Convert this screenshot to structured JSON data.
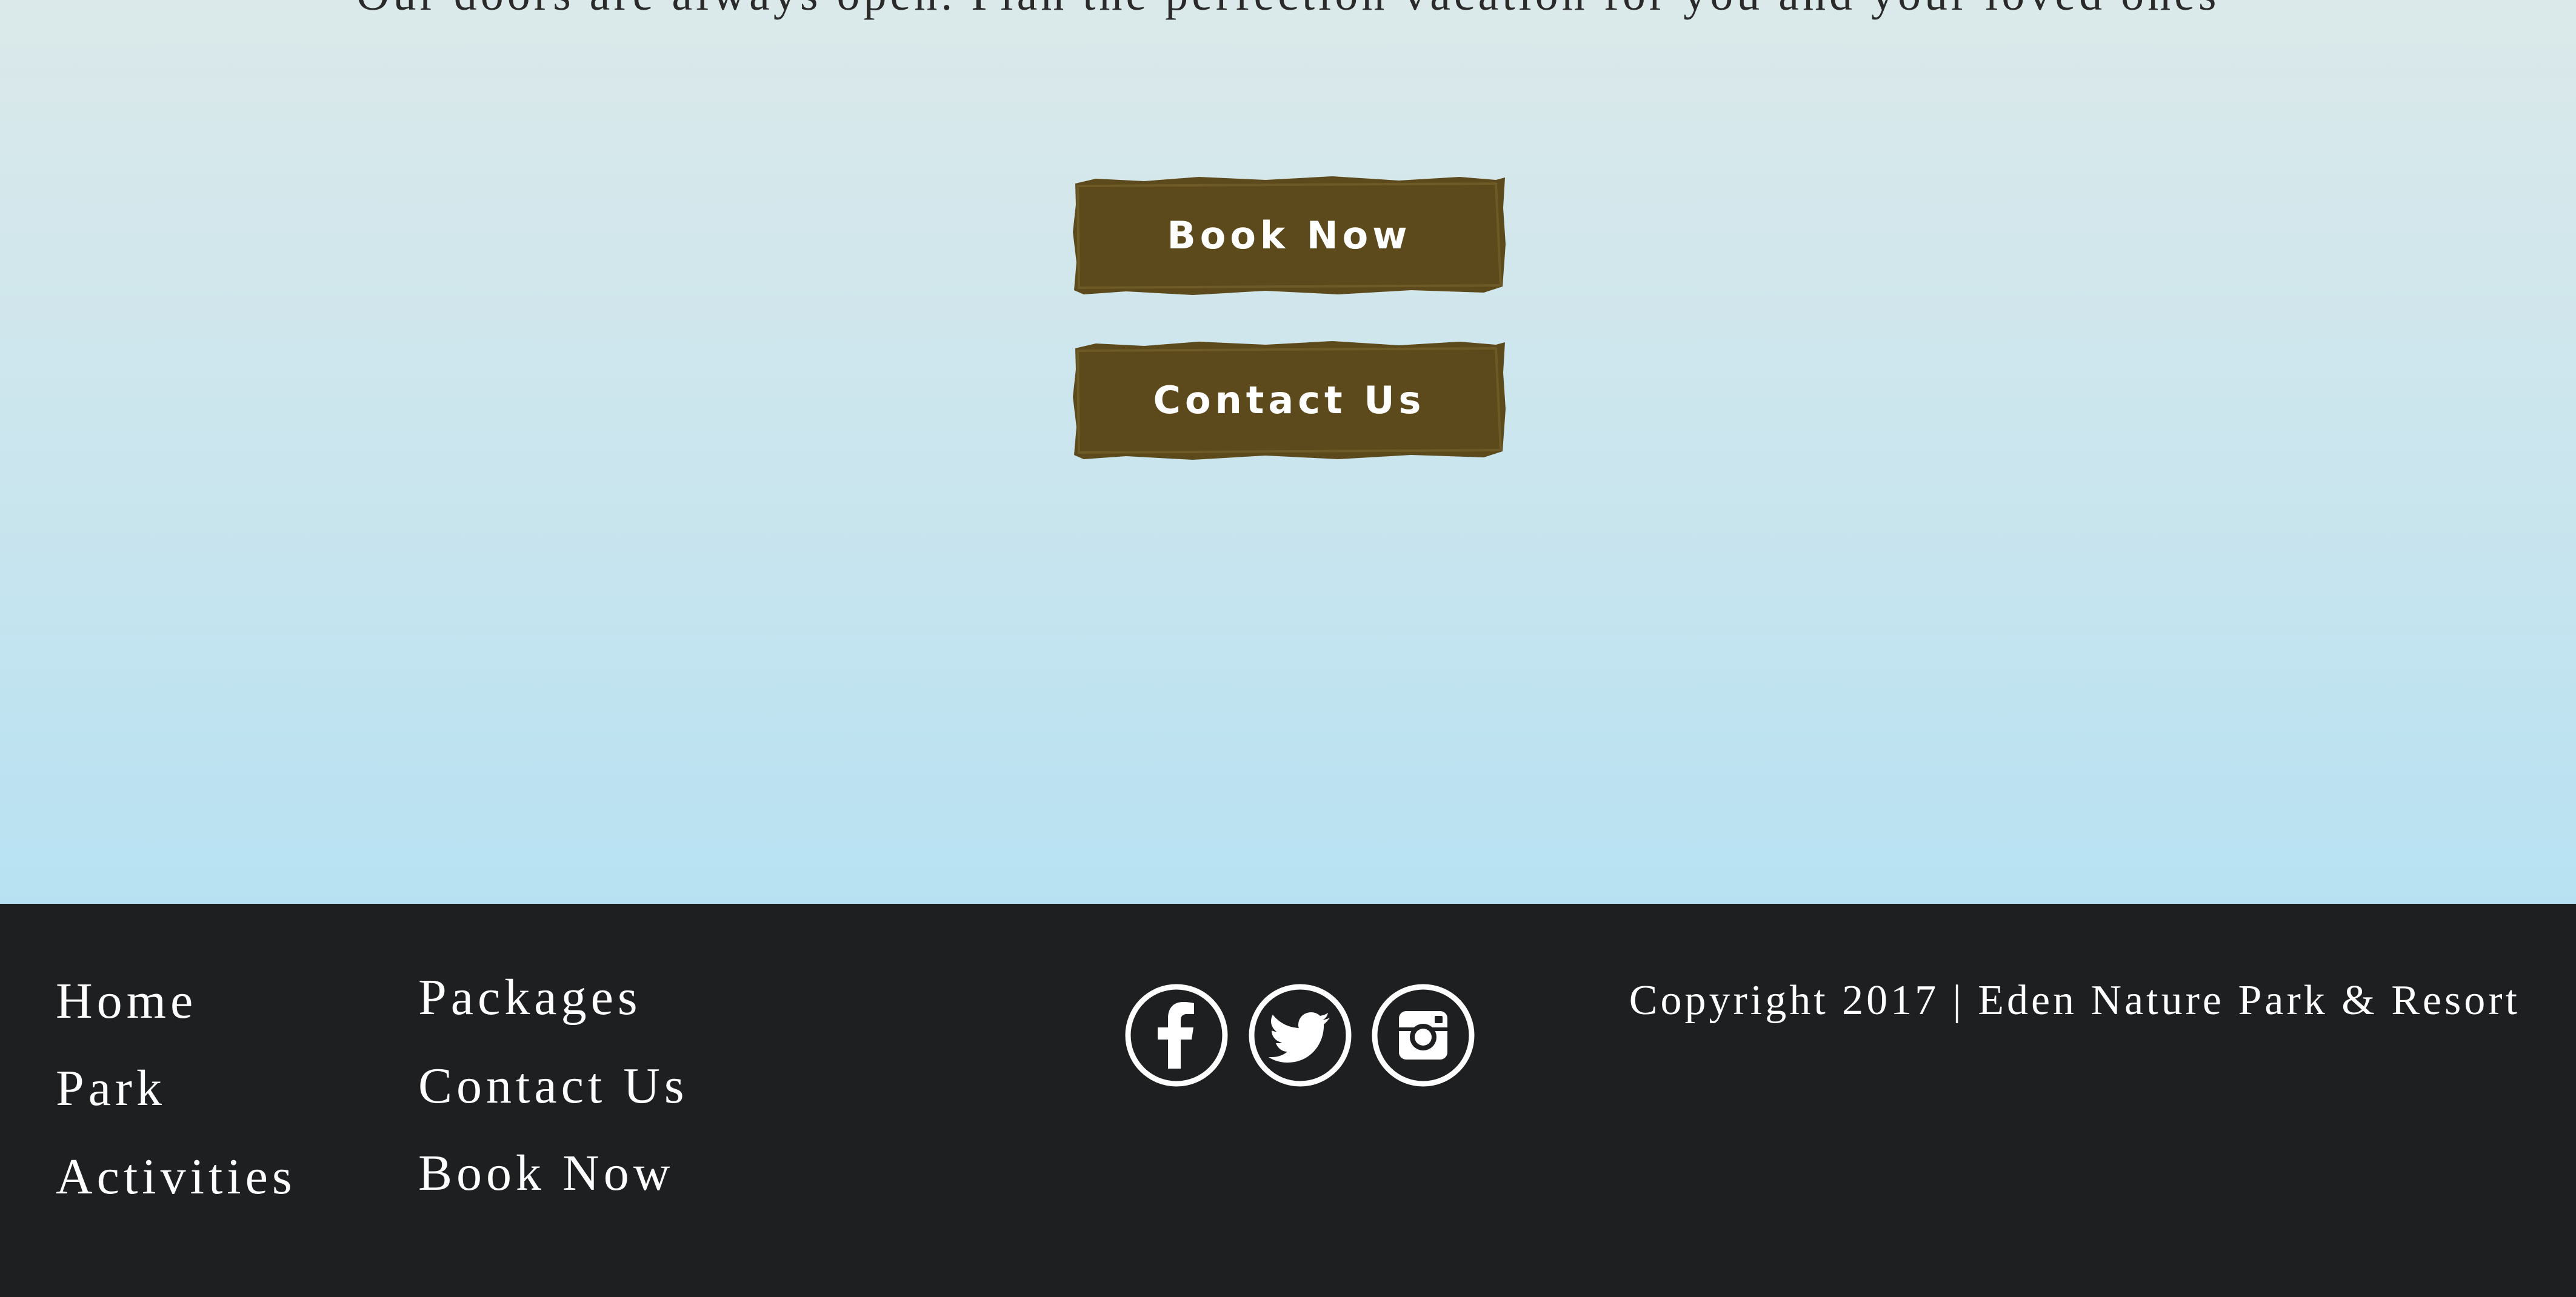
{
  "hero": {
    "tagline": "Our doors are always open. Plan the perfection vacation for you and your loved ones",
    "buttons": {
      "book_now": "Book Now",
      "contact_us": "Contact Us"
    }
  },
  "footer": {
    "nav_col1": [
      "Home",
      "Park",
      "Activities"
    ],
    "nav_col2": [
      "Packages",
      "Contact Us",
      "Book Now"
    ],
    "social": [
      "facebook-icon",
      "twitter-icon",
      "instagram-icon"
    ],
    "copyright": "Copyright 2017 | Eden Nature Park & Resort"
  },
  "colors": {
    "button_brown": "#5c4a1c",
    "footer_bg": "#1e1f21",
    "sky_top": "#dbe9ea",
    "sky_bottom": "#b7e1f2"
  }
}
